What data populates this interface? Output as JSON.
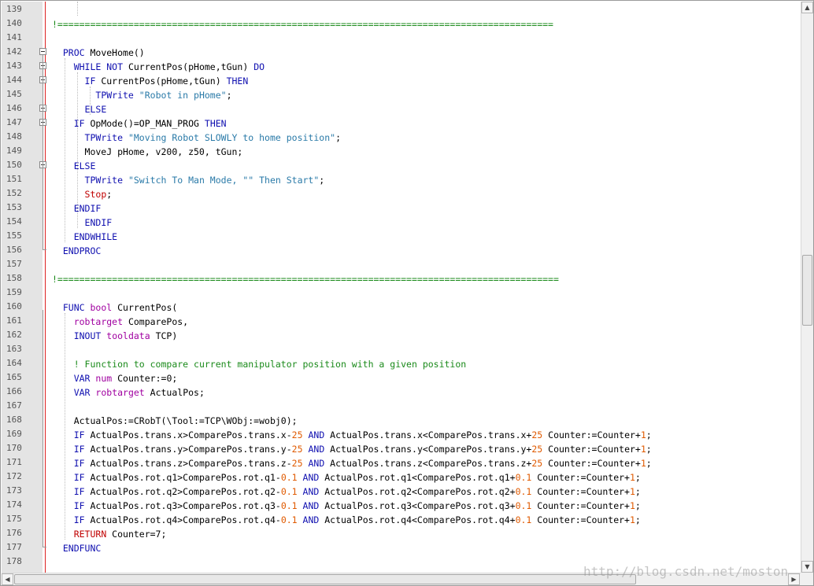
{
  "lines": [
    {
      "n": "139",
      "tokens": []
    },
    {
      "n": "140",
      "tokens": [
        {
          "t": "!===========================================================================================",
          "c": "cmt"
        }
      ]
    },
    {
      "n": "141",
      "tokens": []
    },
    {
      "n": "142",
      "tokens": [
        {
          "t": "  "
        },
        {
          "t": "PROC",
          "c": "kw"
        },
        {
          "t": " MoveHome()"
        }
      ]
    },
    {
      "n": "143",
      "tokens": [
        {
          "t": "    "
        },
        {
          "t": "WHILE NOT",
          "c": "kw"
        },
        {
          "t": " CurrentPos(pHome,tGun) "
        },
        {
          "t": "DO",
          "c": "kw"
        }
      ]
    },
    {
      "n": "144",
      "tokens": [
        {
          "t": "      "
        },
        {
          "t": "IF",
          "c": "kw"
        },
        {
          "t": " CurrentPos(pHome,tGun) "
        },
        {
          "t": "THEN",
          "c": "kw"
        }
      ]
    },
    {
      "n": "145",
      "tokens": [
        {
          "t": "        "
        },
        {
          "t": "TPWrite",
          "c": "kw"
        },
        {
          "t": " "
        },
        {
          "t": "\"Robot in pHome\"",
          "c": "str"
        },
        {
          "t": ";"
        }
      ]
    },
    {
      "n": "146",
      "tokens": [
        {
          "t": "      "
        },
        {
          "t": "ELSE",
          "c": "kw"
        }
      ]
    },
    {
      "n": "147",
      "tokens": [
        {
          "t": "    "
        },
        {
          "t": "IF",
          "c": "kw"
        },
        {
          "t": " OpMode()=OP_MAN_PROG "
        },
        {
          "t": "THEN",
          "c": "kw"
        }
      ]
    },
    {
      "n": "148",
      "tokens": [
        {
          "t": "      "
        },
        {
          "t": "TPWrite",
          "c": "kw"
        },
        {
          "t": " "
        },
        {
          "t": "\"Moving Robot SLOWLY to home position\"",
          "c": "str"
        },
        {
          "t": ";"
        }
      ]
    },
    {
      "n": "149",
      "tokens": [
        {
          "t": "      MoveJ pHome, v200, z50, tGun;"
        }
      ]
    },
    {
      "n": "150",
      "tokens": [
        {
          "t": "    "
        },
        {
          "t": "ELSE",
          "c": "kw"
        }
      ]
    },
    {
      "n": "151",
      "tokens": [
        {
          "t": "      "
        },
        {
          "t": "TPWrite",
          "c": "kw"
        },
        {
          "t": " "
        },
        {
          "t": "\"Switch To Man Mode, \"\" Then Start\"",
          "c": "str"
        },
        {
          "t": ";"
        }
      ]
    },
    {
      "n": "152",
      "tokens": [
        {
          "t": "      "
        },
        {
          "t": "Stop",
          "c": "red"
        },
        {
          "t": ";"
        }
      ]
    },
    {
      "n": "153",
      "tokens": [
        {
          "t": "    "
        },
        {
          "t": "ENDIF",
          "c": "kw"
        }
      ]
    },
    {
      "n": "154",
      "tokens": [
        {
          "t": "      "
        },
        {
          "t": "ENDIF",
          "c": "kw"
        }
      ]
    },
    {
      "n": "155",
      "tokens": [
        {
          "t": "    "
        },
        {
          "t": "ENDWHILE",
          "c": "kw"
        }
      ]
    },
    {
      "n": "156",
      "tokens": [
        {
          "t": "  "
        },
        {
          "t": "ENDPROC",
          "c": "kw"
        }
      ]
    },
    {
      "n": "157",
      "tokens": []
    },
    {
      "n": "158",
      "tokens": [
        {
          "t": "!============================================================================================",
          "c": "cmt"
        }
      ]
    },
    {
      "n": "159",
      "tokens": []
    },
    {
      "n": "160",
      "tokens": [
        {
          "t": "  "
        },
        {
          "t": "FUNC",
          "c": "kw"
        },
        {
          "t": " "
        },
        {
          "t": "bool",
          "c": "kw2"
        },
        {
          "t": " CurrentPos("
        }
      ]
    },
    {
      "n": "161",
      "tokens": [
        {
          "t": "    "
        },
        {
          "t": "robtarget",
          "c": "kw2"
        },
        {
          "t": " ComparePos,"
        }
      ]
    },
    {
      "n": "162",
      "tokens": [
        {
          "t": "    "
        },
        {
          "t": "INOUT",
          "c": "kw"
        },
        {
          "t": " "
        },
        {
          "t": "tooldata",
          "c": "kw2"
        },
        {
          "t": " TCP)"
        }
      ]
    },
    {
      "n": "163",
      "tokens": []
    },
    {
      "n": "164",
      "tokens": [
        {
          "t": "    "
        },
        {
          "t": "! Function to compare current manipulator position with a given position",
          "c": "cmt"
        }
      ]
    },
    {
      "n": "165",
      "tokens": [
        {
          "t": "    "
        },
        {
          "t": "VAR",
          "c": "kw"
        },
        {
          "t": " "
        },
        {
          "t": "num",
          "c": "kw2"
        },
        {
          "t": " Counter:=0;"
        }
      ]
    },
    {
      "n": "166",
      "tokens": [
        {
          "t": "    "
        },
        {
          "t": "VAR",
          "c": "kw"
        },
        {
          "t": " "
        },
        {
          "t": "robtarget",
          "c": "kw2"
        },
        {
          "t": " ActualPos;"
        }
      ]
    },
    {
      "n": "167",
      "tokens": []
    },
    {
      "n": "168",
      "tokens": [
        {
          "t": "    ActualPos:=CRobT(\\Tool:=TCP\\WObj:=wobj0);"
        }
      ]
    },
    {
      "n": "169",
      "tokens": [
        {
          "t": "    "
        },
        {
          "t": "IF",
          "c": "kw"
        },
        {
          "t": " ActualPos.trans.x>ComparePos.trans.x-"
        },
        {
          "t": "25",
          "c": "num"
        },
        {
          "t": " "
        },
        {
          "t": "AND",
          "c": "kw"
        },
        {
          "t": " ActualPos.trans.x<ComparePos.trans.x+"
        },
        {
          "t": "25",
          "c": "num"
        },
        {
          "t": " Counter:=Counter+"
        },
        {
          "t": "1",
          "c": "num"
        },
        {
          "t": ";"
        }
      ]
    },
    {
      "n": "170",
      "tokens": [
        {
          "t": "    "
        },
        {
          "t": "IF",
          "c": "kw"
        },
        {
          "t": " ActualPos.trans.y>ComparePos.trans.y-"
        },
        {
          "t": "25",
          "c": "num"
        },
        {
          "t": " "
        },
        {
          "t": "AND",
          "c": "kw"
        },
        {
          "t": " ActualPos.trans.y<ComparePos.trans.y+"
        },
        {
          "t": "25",
          "c": "num"
        },
        {
          "t": " Counter:=Counter+"
        },
        {
          "t": "1",
          "c": "num"
        },
        {
          "t": ";"
        }
      ]
    },
    {
      "n": "171",
      "tokens": [
        {
          "t": "    "
        },
        {
          "t": "IF",
          "c": "kw"
        },
        {
          "t": " ActualPos.trans.z>ComparePos.trans.z-"
        },
        {
          "t": "25",
          "c": "num"
        },
        {
          "t": " "
        },
        {
          "t": "AND",
          "c": "kw"
        },
        {
          "t": " ActualPos.trans.z<ComparePos.trans.z+"
        },
        {
          "t": "25",
          "c": "num"
        },
        {
          "t": " Counter:=Counter+"
        },
        {
          "t": "1",
          "c": "num"
        },
        {
          "t": ";"
        }
      ]
    },
    {
      "n": "172",
      "tokens": [
        {
          "t": "    "
        },
        {
          "t": "IF",
          "c": "kw"
        },
        {
          "t": " ActualPos.rot.q1>ComparePos.rot.q1-"
        },
        {
          "t": "0.1",
          "c": "num"
        },
        {
          "t": " "
        },
        {
          "t": "AND",
          "c": "kw"
        },
        {
          "t": " ActualPos.rot.q1<ComparePos.rot.q1+"
        },
        {
          "t": "0.1",
          "c": "num"
        },
        {
          "t": " Counter:=Counter+"
        },
        {
          "t": "1",
          "c": "num"
        },
        {
          "t": ";"
        }
      ]
    },
    {
      "n": "173",
      "tokens": [
        {
          "t": "    "
        },
        {
          "t": "IF",
          "c": "kw"
        },
        {
          "t": " ActualPos.rot.q2>ComparePos.rot.q2-"
        },
        {
          "t": "0.1",
          "c": "num"
        },
        {
          "t": " "
        },
        {
          "t": "AND",
          "c": "kw"
        },
        {
          "t": " ActualPos.rot.q2<ComparePos.rot.q2+"
        },
        {
          "t": "0.1",
          "c": "num"
        },
        {
          "t": " Counter:=Counter+"
        },
        {
          "t": "1",
          "c": "num"
        },
        {
          "t": ";"
        }
      ]
    },
    {
      "n": "174",
      "tokens": [
        {
          "t": "    "
        },
        {
          "t": "IF",
          "c": "kw"
        },
        {
          "t": " ActualPos.rot.q3>ComparePos.rot.q3-"
        },
        {
          "t": "0.1",
          "c": "num"
        },
        {
          "t": " "
        },
        {
          "t": "AND",
          "c": "kw"
        },
        {
          "t": " ActualPos.rot.q3<ComparePos.rot.q3+"
        },
        {
          "t": "0.1",
          "c": "num"
        },
        {
          "t": " Counter:=Counter+"
        },
        {
          "t": "1",
          "c": "num"
        },
        {
          "t": ";"
        }
      ]
    },
    {
      "n": "175",
      "tokens": [
        {
          "t": "    "
        },
        {
          "t": "IF",
          "c": "kw"
        },
        {
          "t": " ActualPos.rot.q4>ComparePos.rot.q4-"
        },
        {
          "t": "0.1",
          "c": "num"
        },
        {
          "t": " "
        },
        {
          "t": "AND",
          "c": "kw"
        },
        {
          "t": " ActualPos.rot.q4<ComparePos.rot.q4+"
        },
        {
          "t": "0.1",
          "c": "num"
        },
        {
          "t": " Counter:=Counter+"
        },
        {
          "t": "1",
          "c": "num"
        },
        {
          "t": ";"
        }
      ]
    },
    {
      "n": "176",
      "tokens": [
        {
          "t": "    "
        },
        {
          "t": "RETURN",
          "c": "red"
        },
        {
          "t": " Counter=7;"
        }
      ]
    },
    {
      "n": "177",
      "tokens": [
        {
          "t": "  "
        },
        {
          "t": "ENDFUNC",
          "c": "kw"
        }
      ]
    },
    {
      "n": "178",
      "tokens": []
    }
  ],
  "watermark": "http://blog.csdn.net/moston",
  "scroll": {
    "up_arrow": "▲",
    "down_arrow": "▼",
    "left_arrow": "◀",
    "right_arrow": "▶"
  },
  "colors": {
    "keyword": "#1010b0",
    "type": "#a000a0",
    "string": "#2a7aa8",
    "comment": "#1a8a1a",
    "number": "#e05a00",
    "stop": "#c00000"
  }
}
